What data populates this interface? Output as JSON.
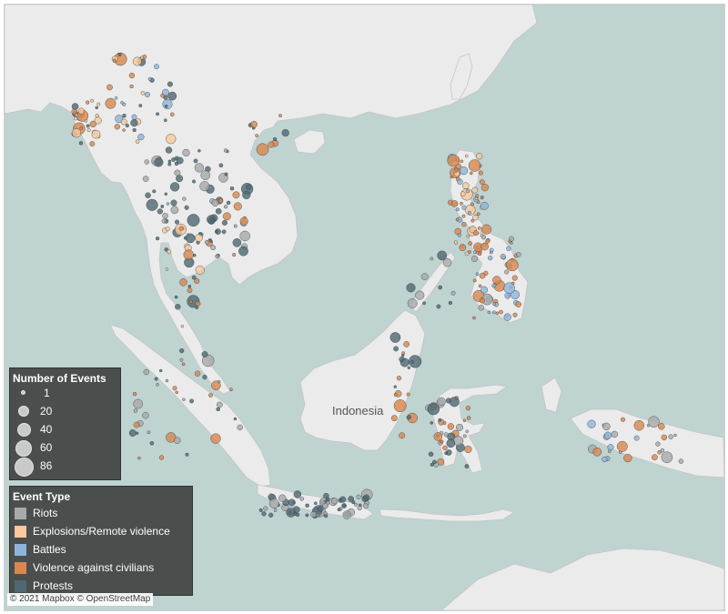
{
  "map": {
    "country_label": "Indonesia",
    "attribution": "© 2021 Mapbox © OpenStreetMap",
    "colors": {
      "water": "#bfd3d1",
      "land": "#ebebeb",
      "border": "#c4c4c4"
    }
  },
  "size_legend": {
    "title": "Number of Events",
    "items": [
      {
        "label": "1",
        "value": 1
      },
      {
        "label": "20",
        "value": 20
      },
      {
        "label": "40",
        "value": 40
      },
      {
        "label": "60",
        "value": 60
      },
      {
        "label": "86",
        "value": 86
      }
    ]
  },
  "type_legend": {
    "title": "Event Type",
    "items": [
      {
        "label": "Riots",
        "color": "#a9a9a9"
      },
      {
        "label": "Explosions/Remote violence",
        "color": "#f9c89b"
      },
      {
        "label": "Battles",
        "color": "#8fb4dc"
      },
      {
        "label": "Violence against civilians",
        "color": "#d9874e"
      },
      {
        "label": "Protests",
        "color": "#4f6872"
      }
    ]
  }
}
